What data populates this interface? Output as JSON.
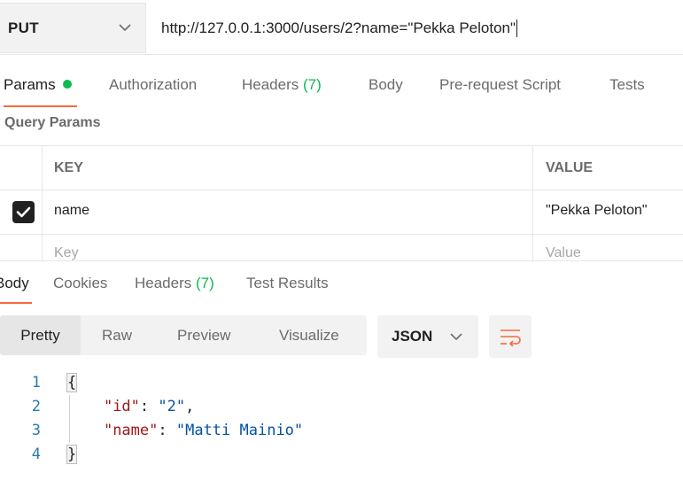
{
  "request": {
    "method": "PUT",
    "url": "http://127.0.0.1:3000/users/2?name=\"Pekka Peloton\""
  },
  "request_tabs": {
    "params": "Params",
    "authorization": "Authorization",
    "headers": "Headers",
    "headers_count": "(7)",
    "body": "Body",
    "prerequest": "Pre-request Script",
    "tests": "Tests"
  },
  "query_params": {
    "title": "Query Params",
    "col_key": "KEY",
    "col_value": "VALUE",
    "rows": [
      {
        "key": "name",
        "value": "\"Pekka Peloton\"",
        "checked": true
      }
    ],
    "new_row": {
      "key_placeholder": "Key",
      "value_placeholder": "Value"
    }
  },
  "response_tabs": {
    "body": "Body",
    "cookies": "Cookies",
    "headers": "Headers",
    "headers_count": "(7)",
    "test_results": "Test Results"
  },
  "viewer": {
    "modes": [
      "Pretty",
      "Raw",
      "Preview",
      "Visualize"
    ],
    "active_mode": "Pretty",
    "format": "JSON",
    "wrap_icon": "wrap-lines-icon"
  },
  "code": {
    "line_numbers": [
      "1",
      "2",
      "3",
      "4"
    ],
    "open_brace": "{",
    "close_brace": "}",
    "entries": [
      {
        "key": "\"id\"",
        "value": "\"2\"",
        "sep": ": ",
        "trail": ","
      },
      {
        "key": "\"name\"",
        "value": "\"Matti Mainio\"",
        "sep": ": ",
        "trail": ""
      }
    ]
  },
  "colors": {
    "accent": "#f26b3a",
    "success": "#0cbb52",
    "json_key": "#a31515",
    "json_string": "#0451a5",
    "line_number": "#2a7ab0"
  }
}
